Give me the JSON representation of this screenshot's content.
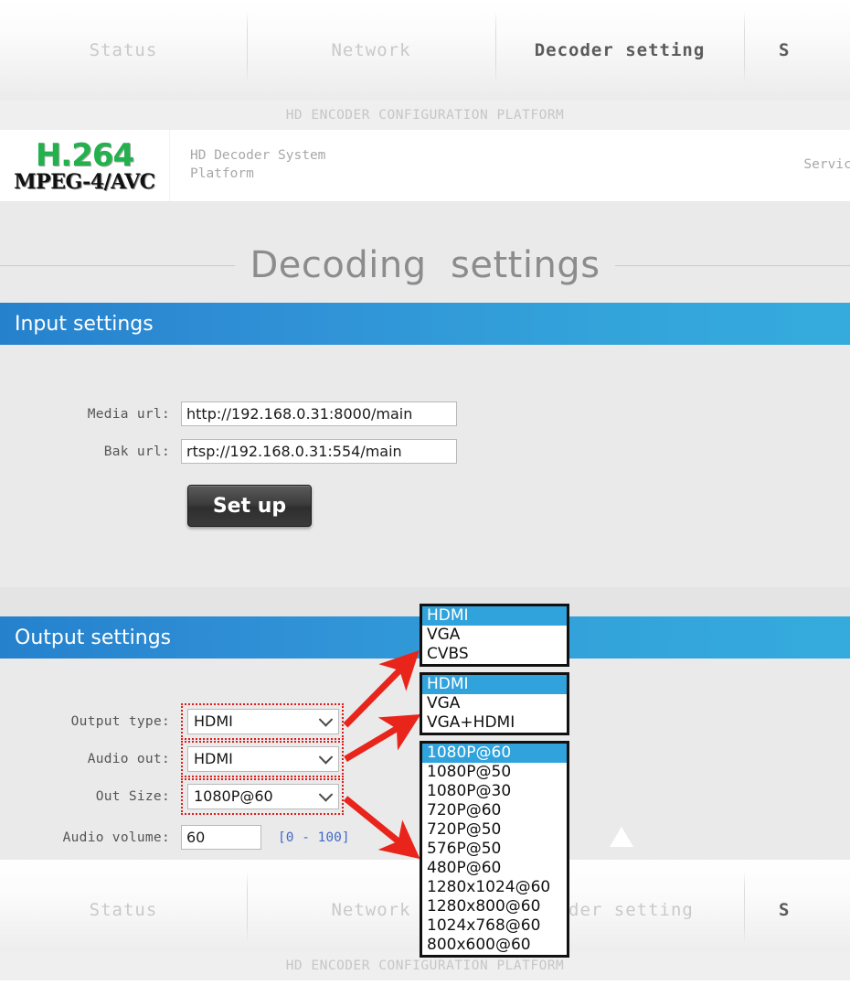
{
  "nav": {
    "tabs": [
      {
        "label": "Status",
        "active": false
      },
      {
        "label": "Network",
        "active": false
      },
      {
        "label": "Decoder setting",
        "active": true
      },
      {
        "label": "S",
        "active": false
      }
    ],
    "platform_text": "HD ENCODER CONFIGURATION PLATFORM"
  },
  "header": {
    "logo_top": "H.264",
    "logo_bottom": "MPEG-4/AVC",
    "logo_color": "#22b14c",
    "system_title": "HD Decoder System Platform",
    "service_text": "Service a"
  },
  "page": {
    "title": "Decoding  settings"
  },
  "input_section": {
    "bar_label": "Input settings",
    "media_url_label": "Media url:",
    "media_url_value": "http://192.168.0.31:8000/main",
    "bak_url_label": "Bak url:",
    "bak_url_value": "rtsp://192.168.0.31:554/main",
    "setup_button": "Set up"
  },
  "output_section": {
    "bar_label": "Output settings",
    "output_type_label": "Output type:",
    "output_type_value": "HDMI",
    "audio_out_label": "Audio out:",
    "audio_out_value": "HDMI",
    "out_size_label": "Out Size:",
    "out_size_value": "1080P@60",
    "audio_volume_label": "Audio volume:",
    "audio_volume_value": "60",
    "audio_volume_range": "[0 - 100]"
  },
  "dropdowns": {
    "output_type": {
      "selected": "HDMI",
      "options": [
        "HDMI",
        "VGA",
        "CVBS"
      ]
    },
    "audio_out": {
      "selected": "HDMI",
      "options": [
        "HDMI",
        "VGA",
        "VGA+HDMI"
      ]
    },
    "out_size": {
      "selected": "1080P@60",
      "options": [
        "1080P@60",
        "1080P@50",
        "1080P@30",
        "720P@60",
        "720P@50",
        "576P@50",
        "480P@60",
        "1280x1024@60",
        "1280x800@60",
        "1024x768@60",
        "800x600@60"
      ]
    }
  },
  "bottom_nav": {
    "tabs": [
      {
        "label": "Status"
      },
      {
        "label": "Network"
      },
      {
        "label": "coder setting"
      },
      {
        "label": "S"
      }
    ],
    "platform_text": "HD ENCODER CONFIGURATION PLATFORM"
  },
  "colors": {
    "accent_blue_left": "#2581cc",
    "accent_blue_right": "#35abdd",
    "highlight_red": "#e01b1b",
    "select_highlight": "#30a3dc"
  }
}
